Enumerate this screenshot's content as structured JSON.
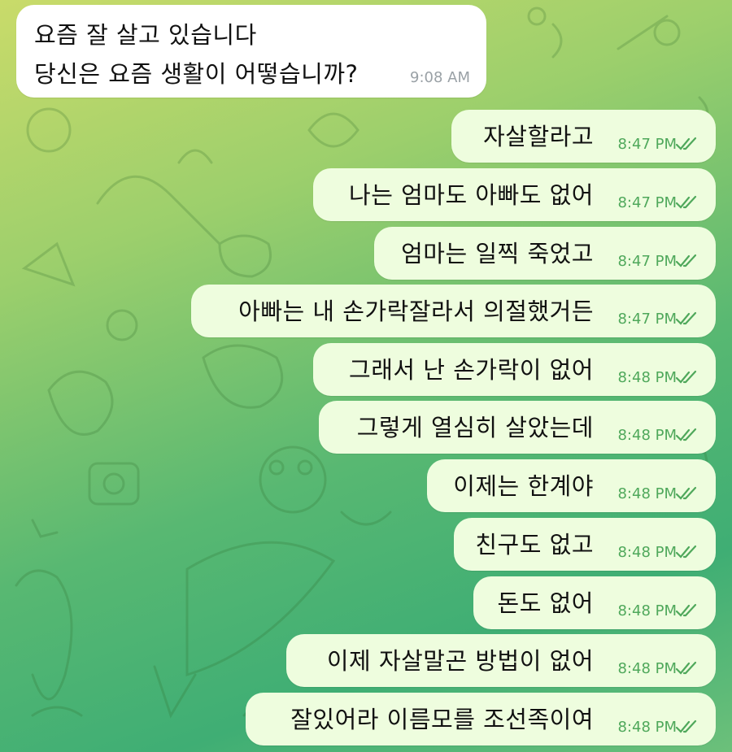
{
  "incoming": {
    "line1": "요즘 잘 살고 있습니다",
    "line2": "당신은 요즘 생활이 어떻습니까?",
    "time": "9:08 AM"
  },
  "outgoing": [
    {
      "text": "자살할라고",
      "time": "8:47 PM"
    },
    {
      "text": "나는 엄마도 아빠도 없어",
      "time": "8:47 PM"
    },
    {
      "text": "엄마는 일찍 죽었고",
      "time": "8:47 PM"
    },
    {
      "text": "아빠는 내 손가락잘라서 의절했거든",
      "time": "8:47 PM"
    },
    {
      "text": "그래서 난 손가락이 없어",
      "time": "8:48 PM"
    },
    {
      "text": "그렇게 열심히 살았는데",
      "time": "8:48 PM"
    },
    {
      "text": "이제는 한계야",
      "time": "8:48 PM"
    },
    {
      "text": "친구도 없고",
      "time": "8:48 PM"
    },
    {
      "text": "돈도 없어",
      "time": "8:48 PM"
    },
    {
      "text": "이제 자살말곤 방법이 없어",
      "time": "8:48 PM"
    },
    {
      "text": "잘있어라 이름모를 조선족이여",
      "time": "8:48 PM"
    }
  ],
  "read_receipt_icon": "double-check-icon",
  "colors": {
    "outgoing_bubble": "#eefdde",
    "incoming_bubble": "#ffffff",
    "outgoing_time": "#4fa85b",
    "incoming_time": "#9aa1a6"
  }
}
